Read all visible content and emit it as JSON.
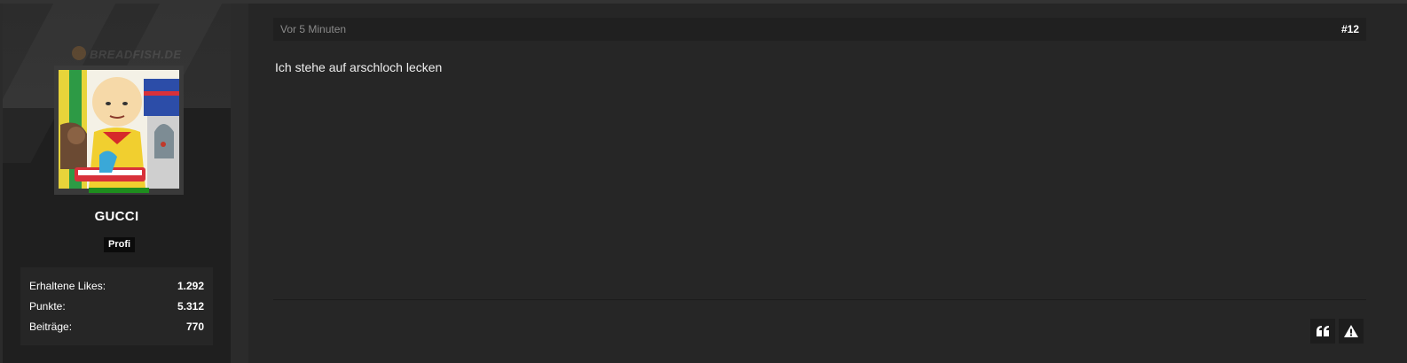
{
  "user": {
    "watermark": "BREADFISH.DE",
    "username": "GUCCI",
    "rank": "Profi",
    "avatar_icon": "cartoon-avatar",
    "online_color": "#1e8d1e",
    "stats": [
      {
        "label": "Erhaltene Likes:",
        "value": "1.292"
      },
      {
        "label": "Punkte:",
        "value": "5.312"
      },
      {
        "label": "Beiträge:",
        "value": "770"
      }
    ]
  },
  "post": {
    "timestamp": "Vor 5 Minuten",
    "number": "#12",
    "content": "Ich stehe auf arschloch lecken"
  },
  "actions": [
    {
      "name": "quote",
      "icon": "quote-icon"
    },
    {
      "name": "report",
      "icon": "warning-icon"
    }
  ]
}
